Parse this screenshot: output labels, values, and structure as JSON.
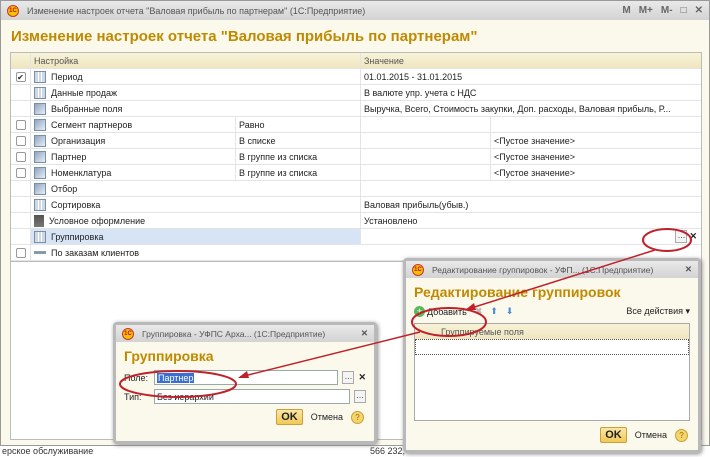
{
  "window": {
    "title": "Изменение настроек отчета \"Валовая прибыль по партнерам\"  (1С:Предприятие)",
    "heading": "Изменение настроек отчета \"Валовая прибыль по партнерам\"",
    "buttons": [
      "M",
      "M+",
      "M-",
      "□",
      "✕"
    ]
  },
  "table": {
    "headers": [
      "Настройка",
      "Значение"
    ],
    "rows": [
      {
        "checked": true,
        "has_cb": true,
        "icon": "grid-icon",
        "name": "Период",
        "value": "01.01.2015 - 31.01.2015"
      },
      {
        "has_cb": false,
        "icon": "grid-icon",
        "name": "Данные продаж",
        "value": "В валюте упр. учета с НДС"
      },
      {
        "has_cb": false,
        "icon": "fields-icon",
        "name": "Выбранные поля",
        "value": "Выручка, Всего, Стоимость закупки, Доп. расходы, Валовая прибыль, Р..."
      }
    ],
    "filters": [
      {
        "name": "Сегмент партнеров",
        "cond": "Равно",
        "value": ""
      },
      {
        "name": "Организация",
        "cond": "В списке",
        "value": "<Пустое значение>"
      },
      {
        "name": "Партнер",
        "cond": "В группе из списка",
        "value": "<Пустое значение>"
      },
      {
        "name": "Номенклатура",
        "cond": "В группе из списка",
        "value": "<Пустое значение>"
      }
    ],
    "rows2": [
      {
        "icon": "filter-icon",
        "name": "Отбор",
        "value": ""
      },
      {
        "icon": "sort-icon",
        "name": "Сортировка",
        "value": "Валовая прибыль(убыв.)"
      },
      {
        "icon": "brush-icon",
        "name": "Условное оформление",
        "value": "Установлено"
      },
      {
        "icon": "grid-icon",
        "name": "Группировка",
        "value": ""
      }
    ],
    "last": {
      "name": "По заказам клиентов"
    }
  },
  "background": {
    "text1": "ерское обслуживание",
    "text2": "566 232,"
  },
  "dialog_group": {
    "title": "Группировка - УФПС Арха...  (1С:Предприятие)",
    "heading": "Группировка",
    "field_label": "Поле:",
    "field_value": "Партнер",
    "type_label": "Тип:",
    "type_value": "Без иерархии",
    "ok": "OK",
    "cancel": "Отмена"
  },
  "dialog_edit": {
    "title": "Редактирование группировок - УФП...  (1С:Предприятие)",
    "heading": "Редактирование группировок",
    "add": "Добавить",
    "all_actions": "Все действия ▾",
    "column": "Группируемые поля",
    "ok": "OK",
    "cancel": "Отмена"
  },
  "colors": {
    "accent": "#c08a00",
    "annotation": "#c0202a"
  }
}
